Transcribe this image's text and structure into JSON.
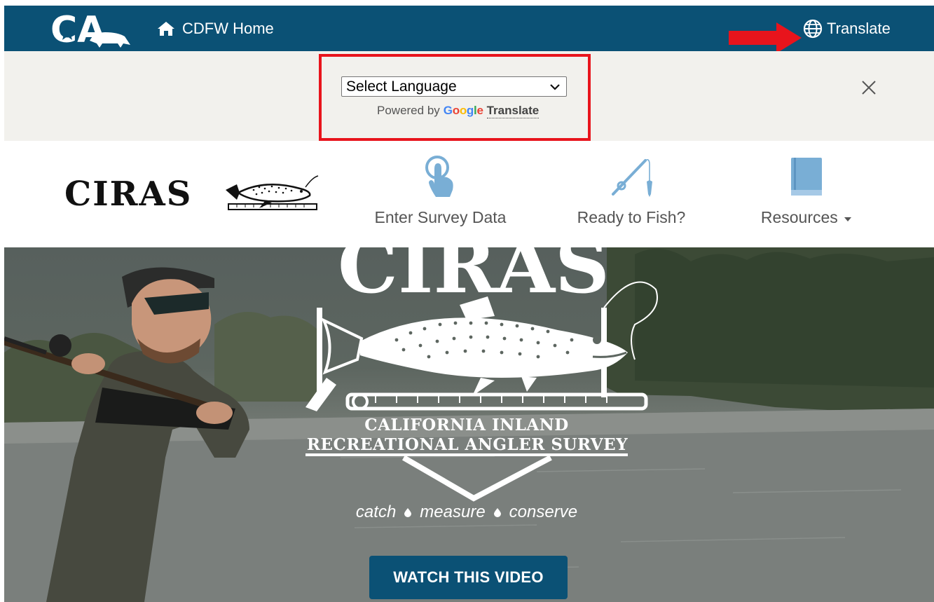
{
  "topbar": {
    "home_label": "CDFW Home",
    "translate_label": "Translate",
    "logo_text": "CA",
    "bg_color": "#0b5175",
    "icons": {
      "home": "home-icon",
      "translate": "globe-icon"
    }
  },
  "translate_bar": {
    "select_value": "Select Language",
    "powered_by": "Powered by",
    "google": [
      "G",
      "o",
      "o",
      "g",
      "l",
      "e"
    ],
    "translate_link": "Translate",
    "highlight_color": "#e8141c",
    "icons": {
      "close": "close-icon",
      "dropdown": "chevron-down-icon"
    }
  },
  "nav": {
    "brand": "CIRAS",
    "items": [
      {
        "label": "Enter Survey Data",
        "icon": "pointer-tap-icon"
      },
      {
        "label": "Ready to Fish?",
        "icon": "fishing-rod-icon"
      },
      {
        "label": "Resources",
        "icon": "book-icon",
        "has_dropdown": true
      }
    ],
    "accent_color": "#79aed5"
  },
  "hero": {
    "logo_title": "CIRAS",
    "subtitle_line1": "CALIFORNIA INLAND",
    "subtitle_line2": "RECREATIONAL ANGLER SURVEY",
    "tagline": [
      "catch",
      "measure",
      "conserve"
    ],
    "cta_label": "WATCH THIS VIDEO"
  }
}
